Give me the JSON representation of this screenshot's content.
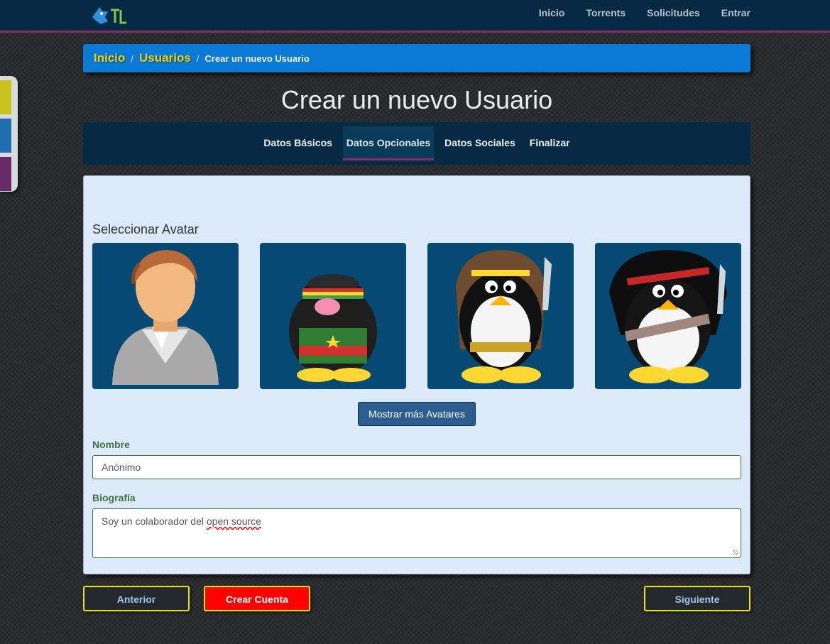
{
  "nav": {
    "links": [
      "Inicio",
      "Torrents",
      "Solicitudes",
      "Entrar"
    ],
    "logo_icon": "blue-bird-logo-icon"
  },
  "breadcrumb": {
    "items": [
      "Inicio",
      "Usuarios"
    ],
    "separator": "/",
    "current": "Crear un nuevo Usuario"
  },
  "page": {
    "title": "Crear un nuevo Usuario"
  },
  "tabs": [
    {
      "label": "Datos Básicos",
      "active": false
    },
    {
      "label": "Datos Opcionales",
      "active": true
    },
    {
      "label": "Datos Sociales",
      "active": false
    },
    {
      "label": "Finalizar",
      "active": false
    }
  ],
  "avatars": {
    "heading": "Seleccionar Avatar",
    "items": [
      {
        "icon": "person-avatar-icon"
      },
      {
        "icon": "rasta-penguin-avatar-icon"
      },
      {
        "icon": "barbarian-penguin-avatar-icon"
      },
      {
        "icon": "rambo-penguin-avatar-icon"
      }
    ],
    "more_button": "Mostrar más Avatares"
  },
  "form": {
    "name_label": "Nombre",
    "name_value": "Anónimo",
    "bio_label": "Biografía",
    "bio_text_prefix": "Soy un colaborador del ",
    "bio_text_misspelled": "open source"
  },
  "buttons": {
    "prev": "Anterior",
    "create": "Crear Cuenta",
    "next": "Siguiente"
  },
  "colors": {
    "navbar": "#062a43",
    "accent": "#8b2a63",
    "breadcrumb": "#0b79d6",
    "link_yellow": "#f0d000",
    "panel": "#dbe9f8",
    "avatar_bg": "#064a74",
    "danger": "#ff0000"
  }
}
